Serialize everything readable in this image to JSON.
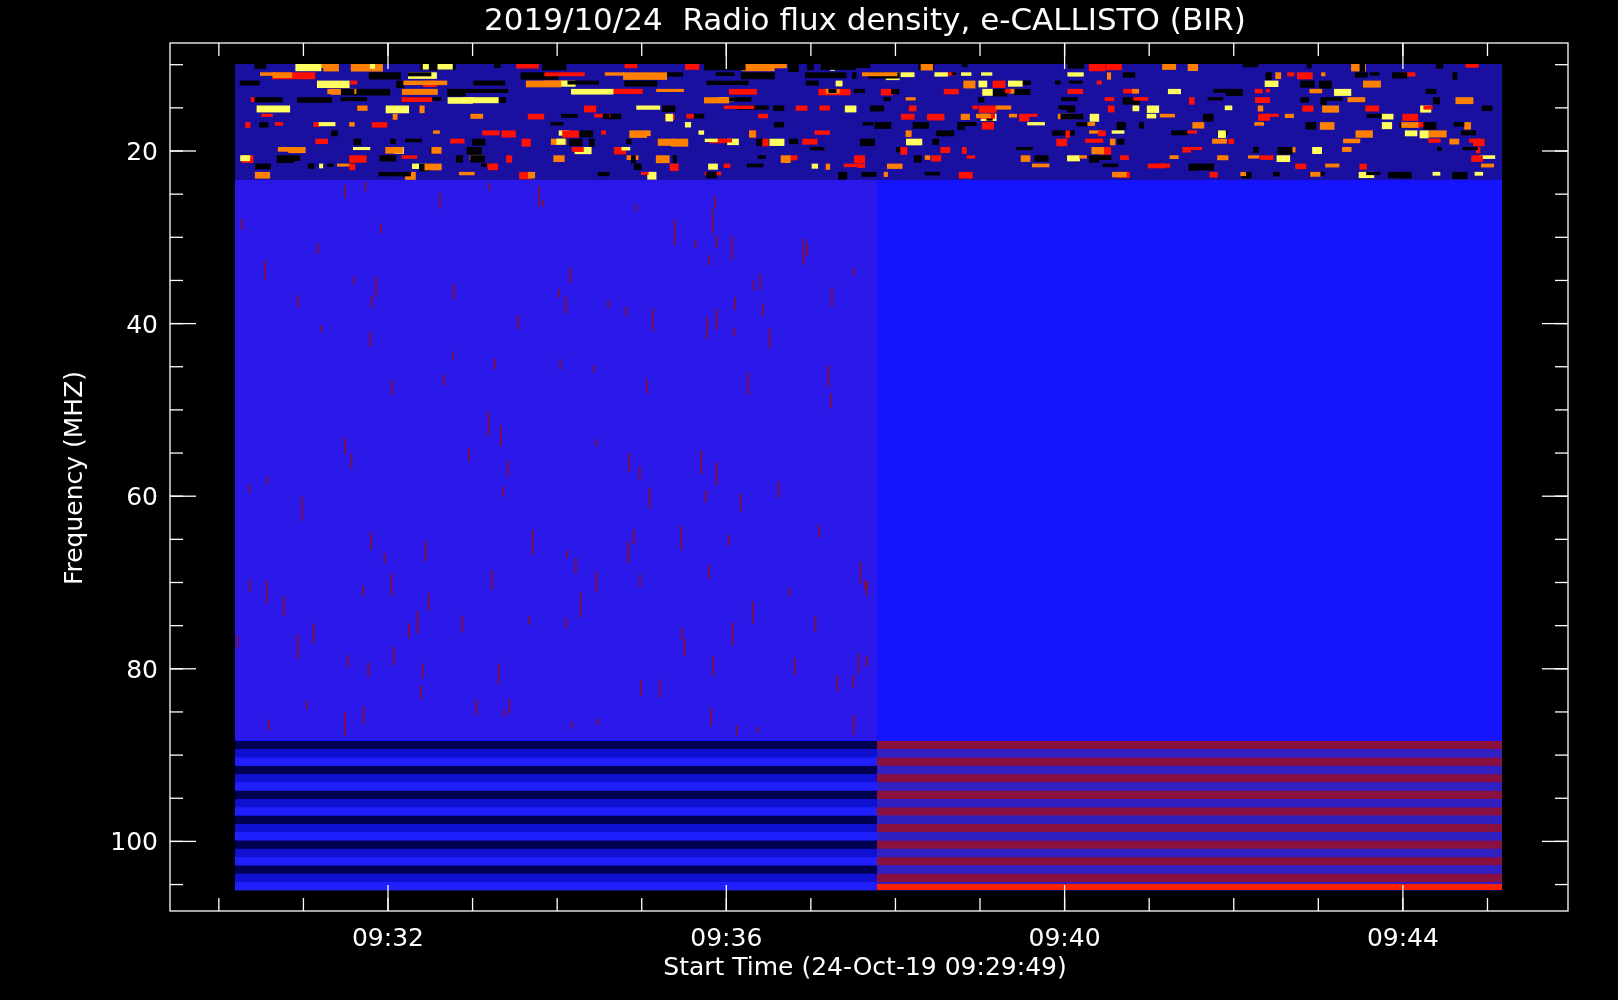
{
  "title": "2019/10/24  Radio flux density, e-CALLISTO (BIR)",
  "ylabel": "Frequency (MHZ)",
  "xlabel": "Start Time (24-Oct-19 09:29:49)",
  "yticks": [
    "20",
    "40",
    "60",
    "80",
    "100"
  ],
  "xticks": [
    "09:32",
    "09:36",
    "09:40",
    "09:44"
  ]
}
